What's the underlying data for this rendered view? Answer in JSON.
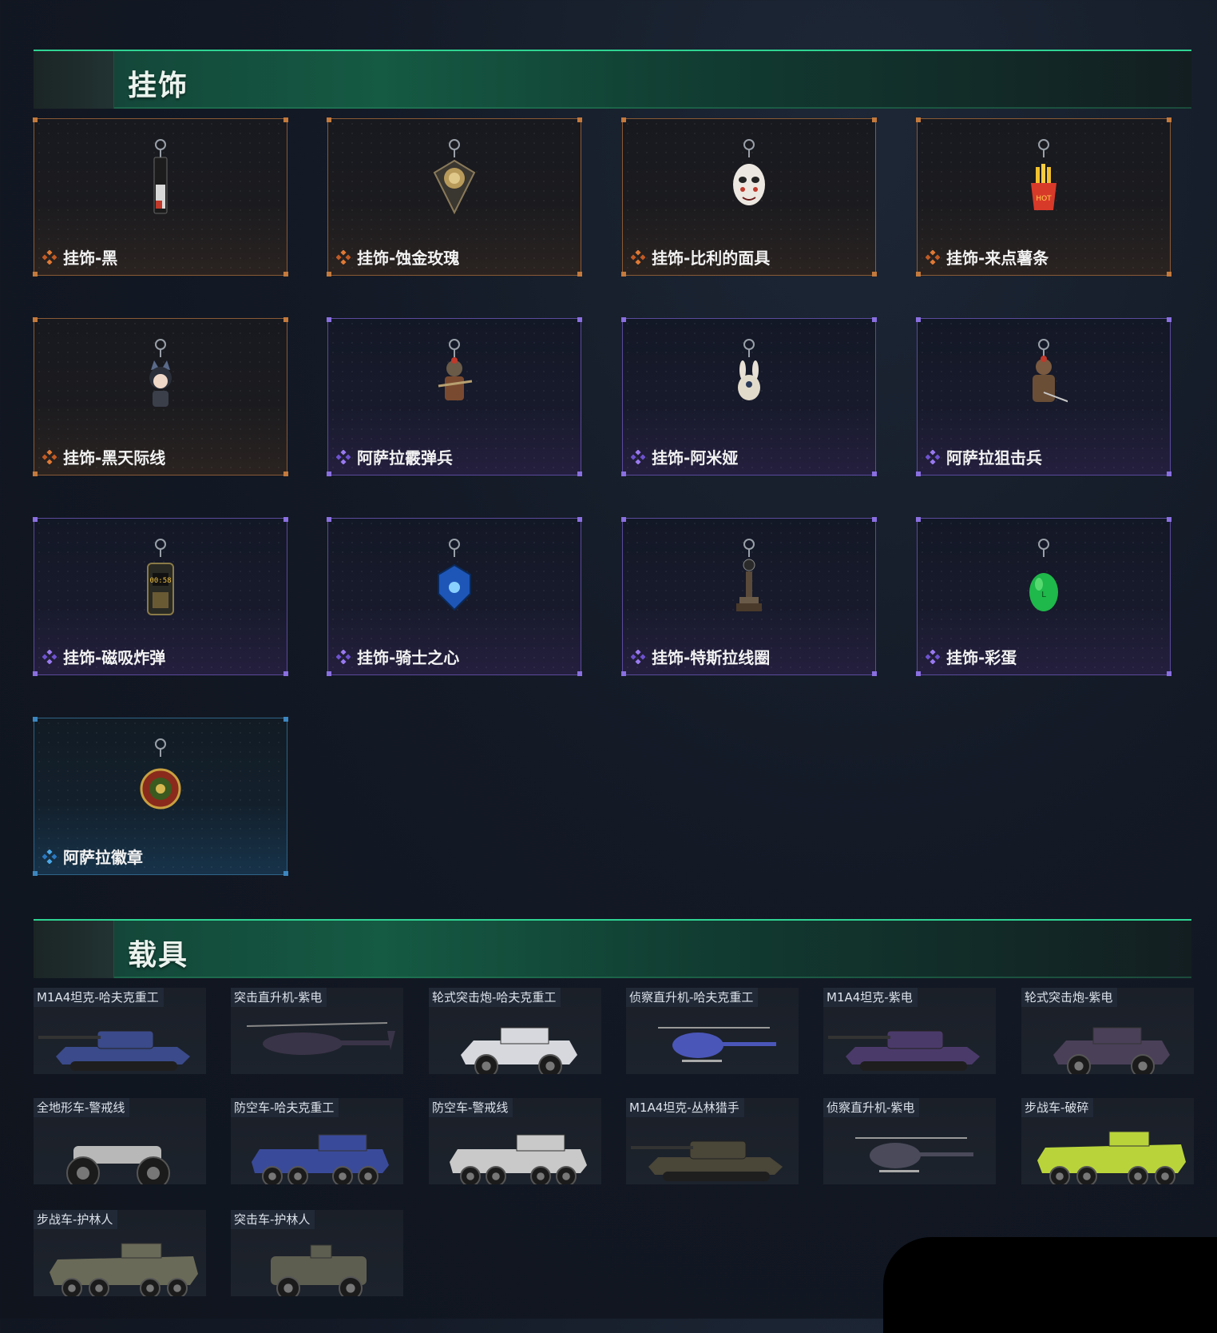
{
  "sections": {
    "charms_title": "挂饰",
    "vehicles_title": "载具"
  },
  "charms": [
    {
      "name": "挂饰-黑",
      "rarity": "orange",
      "icon": "usb-charm-icon"
    },
    {
      "name": "挂饰-蚀金玫瑰",
      "rarity": "orange",
      "icon": "gold-rose-charm-icon"
    },
    {
      "name": "挂饰-比利的面具",
      "rarity": "orange",
      "icon": "billy-mask-charm-icon"
    },
    {
      "name": "挂饰-来点薯条",
      "rarity": "orange",
      "icon": "fries-charm-icon"
    },
    {
      "name": "挂饰-黑天际线",
      "rarity": "orange",
      "icon": "cat-girl-charm-icon"
    },
    {
      "name": "阿萨拉霰弹兵",
      "rarity": "purple",
      "icon": "shotgunner-charm-icon"
    },
    {
      "name": "挂饰-阿米娅",
      "rarity": "purple",
      "icon": "amiya-charm-icon"
    },
    {
      "name": "阿萨拉狙击兵",
      "rarity": "purple",
      "icon": "sniper-charm-icon"
    },
    {
      "name": "挂饰-磁吸炸弹",
      "rarity": "purple",
      "icon": "magnet-bomb-charm-icon"
    },
    {
      "name": "挂饰-骑士之心",
      "rarity": "purple",
      "icon": "knight-heart-charm-icon"
    },
    {
      "name": "挂饰-特斯拉线圈",
      "rarity": "purple",
      "icon": "tesla-coil-charm-icon"
    },
    {
      "name": "挂饰-彩蛋",
      "rarity": "purple",
      "icon": "easter-egg-charm-icon"
    },
    {
      "name": "阿萨拉徽章",
      "rarity": "blue",
      "icon": "asala-badge-charm-icon"
    }
  ],
  "vehicles": [
    {
      "name": "M1A4坦克-哈夫克重工",
      "type": "tank",
      "color": "#3a4a8a"
    },
    {
      "name": "突击直升机-紫电",
      "type": "attack-heli",
      "color": "#3a3448"
    },
    {
      "name": "轮式突击炮-哈夫克重工",
      "type": "wheeled-gun",
      "color": "#d6d8de"
    },
    {
      "name": "侦察直升机-哈夫克重工",
      "type": "scout-heli",
      "color": "#4a56b8"
    },
    {
      "name": "M1A4坦克-紫电",
      "type": "tank",
      "color": "#4a3a6a"
    },
    {
      "name": "轮式突击炮-紫电",
      "type": "wheeled-gun",
      "color": "#4a4058"
    },
    {
      "name": "全地形车-警戒线",
      "type": "atv",
      "color": "#b8b8b8"
    },
    {
      "name": "防空车-哈夫克重工",
      "type": "aa-8wheel",
      "color": "#3a4a9a"
    },
    {
      "name": "防空车-警戒线",
      "type": "aa-8wheel",
      "color": "#c9c9c9"
    },
    {
      "name": "M1A4坦克-丛林猎手",
      "type": "tank",
      "color": "#4a4638"
    },
    {
      "name": "侦察直升机-紫电",
      "type": "scout-heli",
      "color": "#4a4a5a"
    },
    {
      "name": "步战车-破碎",
      "type": "ifv",
      "color": "#b9d43a"
    },
    {
      "name": "步战车-护林人",
      "type": "ifv",
      "color": "#6a6a58"
    },
    {
      "name": "突击车-护林人",
      "type": "assault-car",
      "color": "#5e5e50"
    }
  ]
}
